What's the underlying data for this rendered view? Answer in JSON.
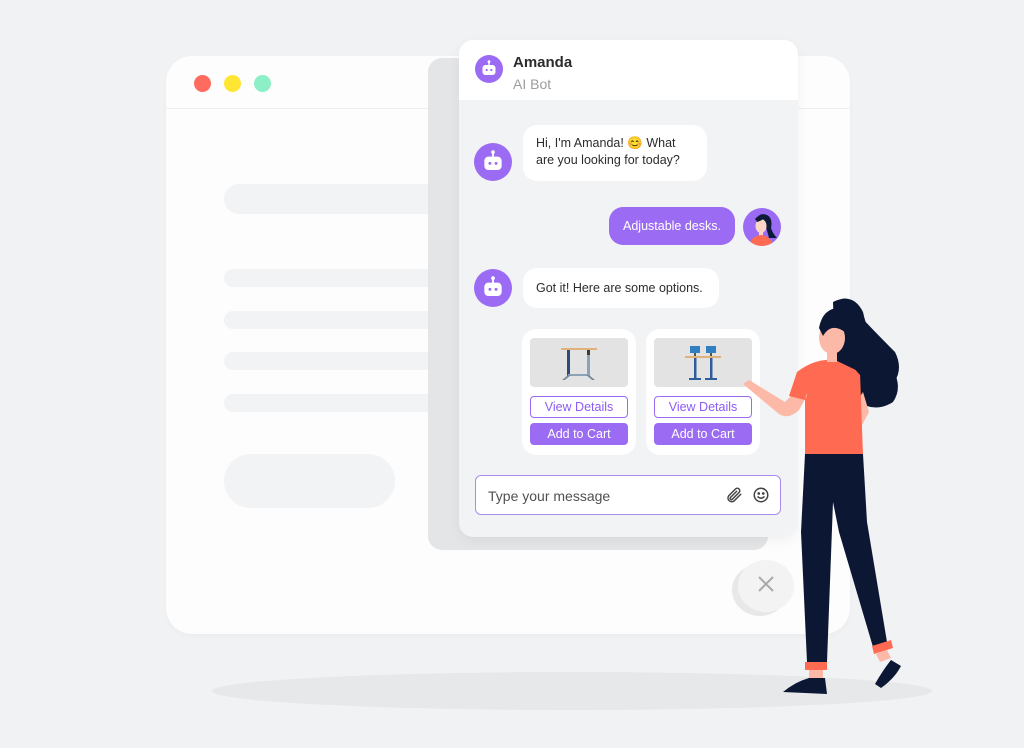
{
  "window_controls": {
    "close_color": "#ff6b5e",
    "minimize_color": "#ffe633",
    "maximize_color": "#8cefc6"
  },
  "chat": {
    "header": {
      "name": "Amanda",
      "subtitle": "AI Bot",
      "avatar_icon": "robot-icon"
    },
    "messages": [
      {
        "sender": "bot",
        "text": "Hi, I'm Amanda! 😊 What are you looking for today?"
      },
      {
        "sender": "user",
        "text": "Adjustable desks."
      },
      {
        "sender": "bot",
        "text": "Got it! Here are some options."
      }
    ],
    "products": [
      {
        "image": "standing-desk",
        "view_label": "View Details",
        "cart_label": "Add to Cart"
      },
      {
        "image": "dual-standing-desk",
        "view_label": "View Details",
        "cart_label": "Add to Cart"
      }
    ],
    "input": {
      "placeholder": "Type your message",
      "value": ""
    },
    "accent_color": "#9b6cf3"
  },
  "close_button": {
    "icon": "close-icon"
  }
}
